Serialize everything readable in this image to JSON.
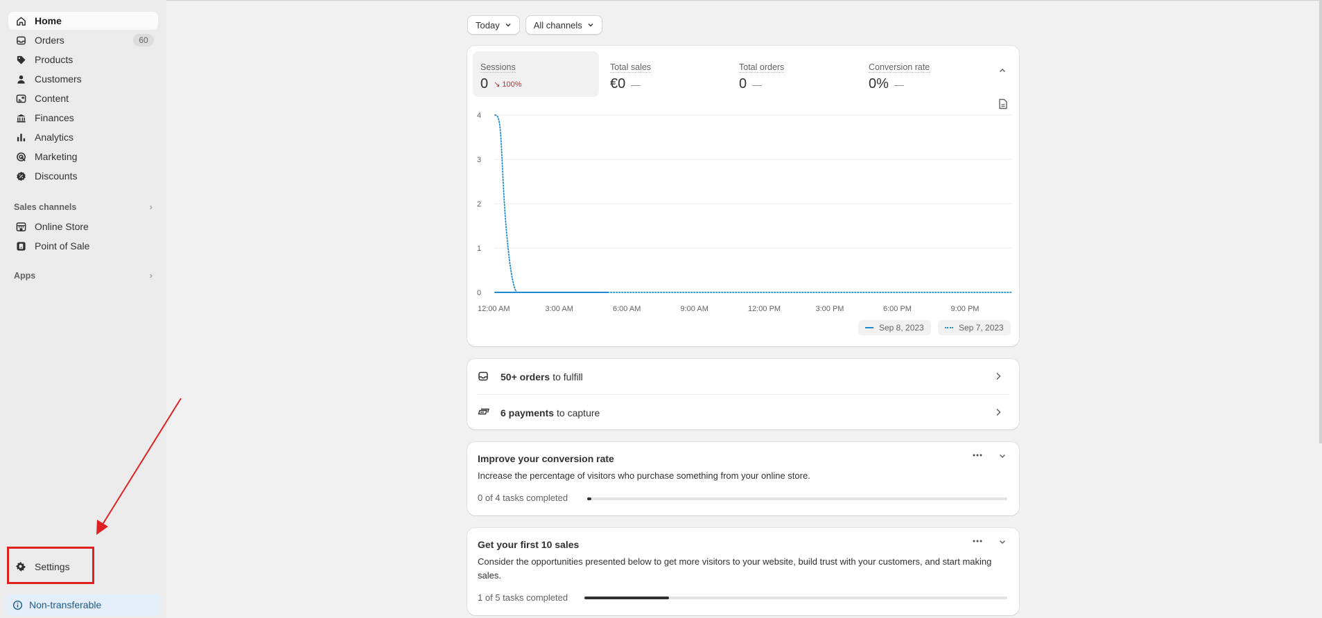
{
  "sidebar": {
    "items": [
      {
        "label": "Home",
        "icon": "home-icon"
      },
      {
        "label": "Orders",
        "icon": "inbox-icon",
        "badge": "60"
      },
      {
        "label": "Products",
        "icon": "tag-icon"
      },
      {
        "label": "Customers",
        "icon": "person-icon"
      },
      {
        "label": "Content",
        "icon": "image-icon"
      },
      {
        "label": "Finances",
        "icon": "bank-icon"
      },
      {
        "label": "Analytics",
        "icon": "bar-chart-icon"
      },
      {
        "label": "Marketing",
        "icon": "target-icon"
      },
      {
        "label": "Discounts",
        "icon": "discount-icon"
      }
    ],
    "sales_channels_label": "Sales channels",
    "channels": [
      {
        "label": "Online Store",
        "icon": "store-icon"
      },
      {
        "label": "Point of Sale",
        "icon": "pos-icon"
      }
    ],
    "apps_label": "Apps",
    "settings_label": "Settings",
    "non_transferable_label": "Non-transferable"
  },
  "filters": {
    "date_label": "Today",
    "channel_label": "All channels"
  },
  "metrics": [
    {
      "label": "Sessions",
      "value": "0",
      "delta": "100%"
    },
    {
      "label": "Total sales",
      "value": "€0",
      "delta": "—"
    },
    {
      "label": "Total orders",
      "value": "0",
      "delta": "—"
    },
    {
      "label": "Conversion rate",
      "value": "0%",
      "delta": "—"
    }
  ],
  "chart_data": {
    "type": "line",
    "x": [
      "12:00 AM",
      "3:00 AM",
      "6:00 AM",
      "9:00 AM",
      "12:00 PM",
      "3:00 PM",
      "6:00 PM",
      "9:00 PM"
    ],
    "y_ticks": [
      "0",
      "1",
      "2",
      "3",
      "4"
    ],
    "ylim": [
      0,
      4
    ],
    "grid": true,
    "legend_position": "bottom-right",
    "series": [
      {
        "name": "Sep 8, 2023",
        "style": "solid",
        "color": "#1a8ad1",
        "points": [
          [
            0,
            0
          ],
          [
            1,
            0
          ],
          [
            2,
            0
          ],
          [
            3,
            0
          ],
          [
            4,
            0
          ],
          [
            5,
            0
          ]
        ]
      },
      {
        "name": "Sep 7, 2023",
        "style": "dotted",
        "color": "#1a8ad1",
        "points": [
          [
            0,
            4
          ],
          [
            0.3,
            3.6
          ],
          [
            0.6,
            1.2
          ],
          [
            1,
            0
          ],
          [
            2,
            0
          ],
          [
            5,
            0
          ],
          [
            10,
            0
          ],
          [
            15,
            0
          ],
          [
            20,
            0
          ],
          [
            23,
            0
          ]
        ]
      }
    ]
  },
  "tasks": [
    {
      "bold": "50+ orders",
      "rest": "to fulfill",
      "icon": "inbox-icon"
    },
    {
      "bold": "6 payments",
      "rest": "to capture",
      "icon": "payment-icon"
    }
  ],
  "setup_cards": [
    {
      "title": "Improve your conversion rate",
      "description": "Increase the percentage of visitors who purchase something from your online store.",
      "progress_label": "0 of 4 tasks completed",
      "progress": 0.0
    },
    {
      "title": "Get your first 10 sales",
      "description": "Consider the opportunities presented below to get more visitors to your website, build trust with your customers, and start making sales.",
      "progress_label": "1 of 5 tasks completed",
      "progress": 0.2
    }
  ],
  "colors": {
    "accent": "#1a8ad1",
    "negative": "#c7272a",
    "highlight_box": "#e02020",
    "info_bg": "#e3eef9"
  }
}
